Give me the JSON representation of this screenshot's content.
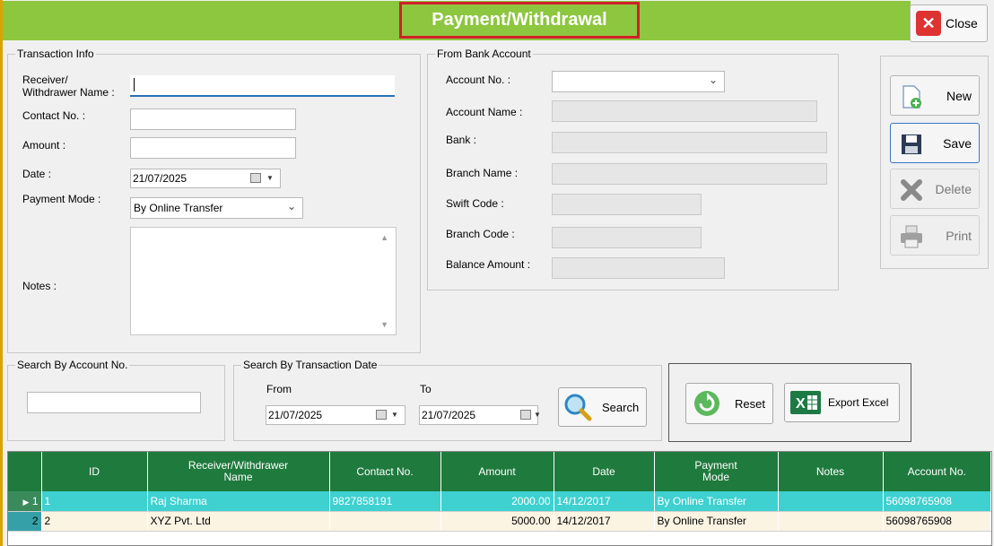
{
  "window": {
    "title": "Payment/Withdrawal",
    "close_label": "Close"
  },
  "transaction_info": {
    "legend": "Transaction Info",
    "receiver_label_line1": "Receiver/",
    "receiver_label_line2": "Withdrawer Name :",
    "receiver_value": "",
    "contact_label": "Contact No. :",
    "contact_value": "",
    "amount_label": "Amount :",
    "amount_value": "",
    "date_label": "Date :",
    "date_value": "21/07/2025",
    "payment_mode_label": "Payment Mode :",
    "payment_mode_value": "By Online Transfer",
    "notes_label": "Notes :",
    "notes_value": ""
  },
  "bank_account": {
    "legend": "From Bank Account",
    "account_no_label": "Account No. :",
    "account_no_value": "",
    "account_name_label": "Account Name :",
    "bank_label": "Bank :",
    "branch_name_label": "Branch Name :",
    "swift_code_label": "Swift Code :",
    "branch_code_label": "Branch Code :",
    "balance_label": "Balance Amount :"
  },
  "actions": {
    "new": "New",
    "save": "Save",
    "delete": "Delete",
    "print": "Print"
  },
  "search_account": {
    "legend": "Search By Account No.",
    "value": ""
  },
  "search_date": {
    "legend": "Search By Transaction Date",
    "from_label": "From",
    "from_value": "21/07/2025",
    "to_label": "To",
    "to_value": "21/07/2025",
    "search_label": "Search"
  },
  "tools": {
    "reset": "Reset",
    "export": "Export Excel"
  },
  "grid": {
    "headers": {
      "id": "ID",
      "receiver_line1": "Receiver/Withdrawer",
      "receiver_line2": "Name",
      "contact": "Contact No.",
      "amount": "Amount",
      "date": "Date",
      "mode_line1": "Payment",
      "mode_line2": "Mode",
      "notes": "Notes",
      "account": "Account No."
    },
    "rows": [
      {
        "row_no": "1",
        "id": "1",
        "name": "Raj Sharma",
        "contact": "9827858191",
        "amount": "2000.00",
        "date": "14/12/2017",
        "mode": "By Online Transfer",
        "notes": "",
        "account": "56098765908"
      },
      {
        "row_no": "2",
        "id": "2",
        "name": "XYZ Pvt. Ltd",
        "contact": "",
        "amount": "5000.00",
        "date": "14/12/2017",
        "mode": "By Online Transfer",
        "notes": "",
        "account": "56098765908"
      }
    ]
  }
}
